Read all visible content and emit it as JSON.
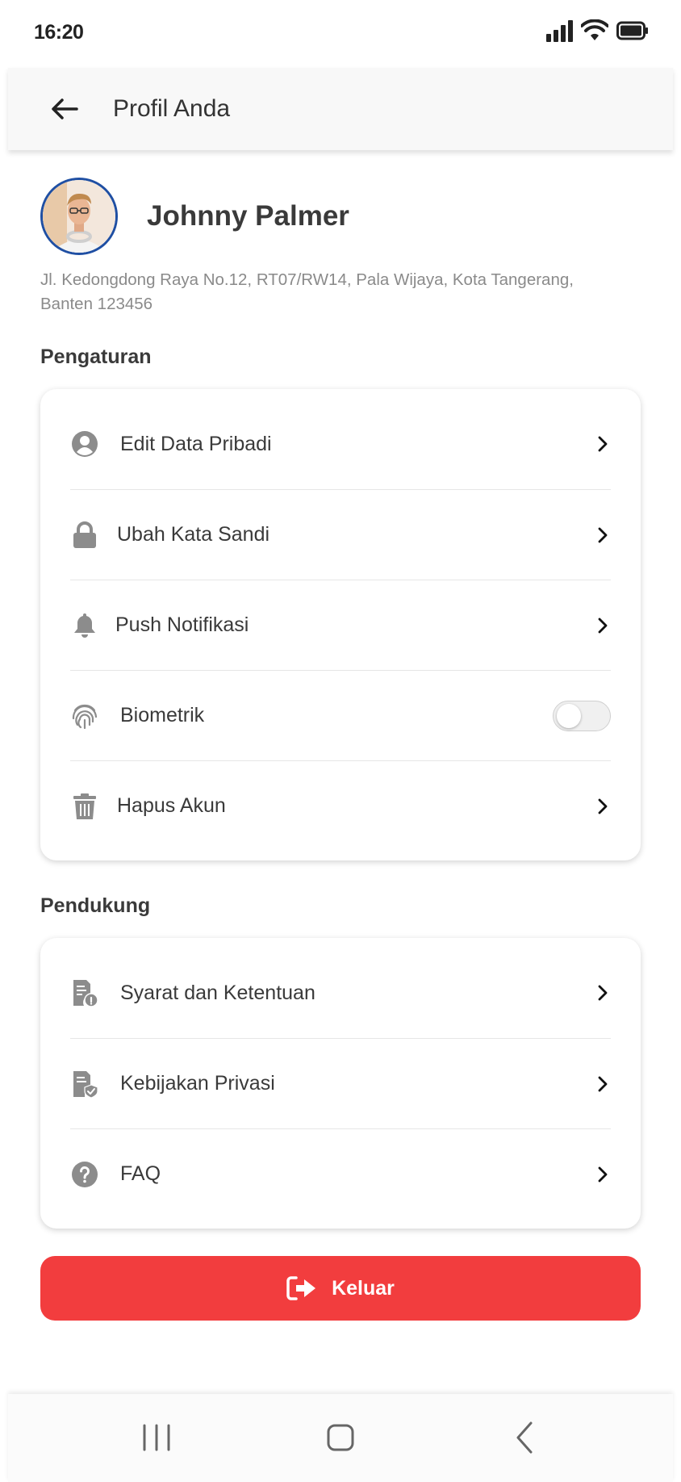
{
  "status_bar": {
    "time": "16:20",
    "icons": [
      "signal-icon",
      "wifi-icon",
      "battery-icon"
    ]
  },
  "app_bar": {
    "title": "Profil Anda",
    "back_icon": "arrow-left-icon"
  },
  "profile": {
    "name": "Johnny Palmer",
    "address": "Jl. Kedongdong Raya No.12, RT07/RW14, Pala Wijaya, Kota Tangerang, Banten 123456",
    "avatar_ring_color": "#1f4fa3"
  },
  "settings": {
    "title": "Pengaturan",
    "items": [
      {
        "label": "Edit Data Pribadi",
        "icon": "user-circle-icon"
      },
      {
        "label": "Ubah Kata Sandi",
        "icon": "lock-icon"
      },
      {
        "label": "Push Notifikasi",
        "icon": "bell-icon"
      },
      {
        "label": "Biometrik",
        "icon": "fingerprint-icon",
        "toggle": false
      },
      {
        "label": "Hapus Akun",
        "icon": "trash-icon"
      }
    ]
  },
  "support": {
    "title": "Pendukung",
    "items": [
      {
        "label": "Syarat dan Ketentuan",
        "icon": "document-info-icon"
      },
      {
        "label": "Kebijakan Privasi",
        "icon": "document-shield-icon"
      },
      {
        "label": "FAQ",
        "icon": "question-circle-icon"
      }
    ]
  },
  "logout": {
    "label": "Keluar",
    "icon": "sign-out-icon",
    "color": "#f23d3e"
  },
  "colors": {
    "icon_gray": "#8c8c8c",
    "text_dark": "#3a3a3a",
    "text_muted": "#8a8a8a"
  }
}
